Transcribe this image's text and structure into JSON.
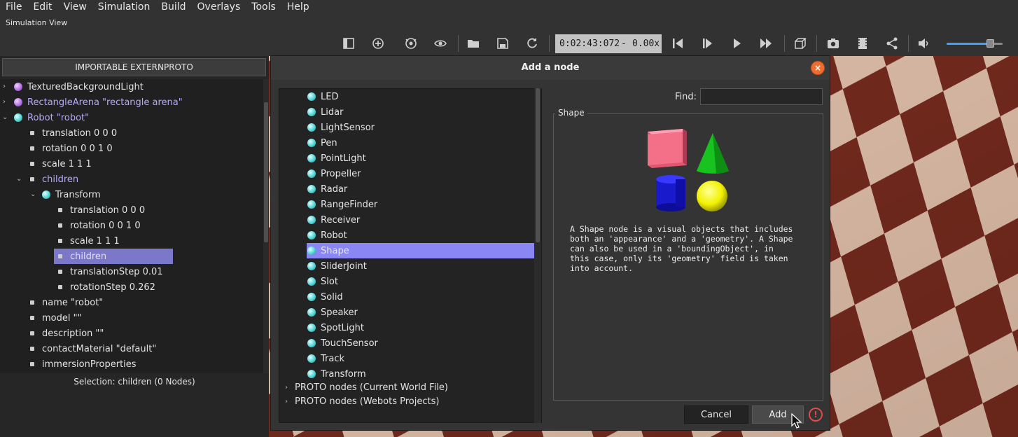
{
  "menu": [
    "File",
    "Edit",
    "View",
    "Simulation",
    "Build",
    "Overlays",
    "Tools",
    "Help"
  ],
  "simulation_view_label": "Simulation View",
  "toolbar": {
    "time": "0:02:43:072",
    "time_separator": "-",
    "speed": "0.00x",
    "volume_level": 0.75,
    "icons": [
      "toggle-scene-tree-icon",
      "add-node-icon",
      "reset-view-icon",
      "visibility-icon",
      "open-world-icon",
      "save-world-icon",
      "reload-world-icon",
      "step-back-icon",
      "step-icon",
      "play-icon",
      "fast-forward-icon",
      "view-cube-icon",
      "screenshot-icon",
      "movie-icon",
      "share-icon",
      "volume-icon"
    ]
  },
  "left_panel": {
    "externproto_button": "IMPORTABLE EXTERNPROTO",
    "tree": [
      {
        "label": "TexturedBackgroundLight"
      },
      {
        "label": "RectangleArena \"rectangle arena\""
      },
      {
        "label": "Robot \"robot\""
      },
      {
        "label": "translation 0 0 0"
      },
      {
        "label": "rotation 0 0 1 0"
      },
      {
        "label": "scale 1 1 1"
      },
      {
        "label": "children"
      },
      {
        "label": "Transform"
      },
      {
        "label": "translation 0 0 0"
      },
      {
        "label": "rotation 0 0 1 0"
      },
      {
        "label": "scale 1 1 1"
      },
      {
        "label": "children"
      },
      {
        "label": "translationStep 0.01"
      },
      {
        "label": "rotationStep 0.262"
      },
      {
        "label": "name \"robot\""
      },
      {
        "label": "model \"\""
      },
      {
        "label": "description \"\""
      },
      {
        "label": "contactMaterial \"default\""
      },
      {
        "label": "immersionProperties"
      }
    ],
    "selection_status": "Selection: children (0 Nodes)"
  },
  "dialog": {
    "title": "Add a node",
    "nodes": [
      "LED",
      "Lidar",
      "LightSensor",
      "Pen",
      "PointLight",
      "Propeller",
      "Radar",
      "RangeFinder",
      "Receiver",
      "Robot",
      "Shape",
      "SliderJoint",
      "Slot",
      "Solid",
      "Speaker",
      "SpotLight",
      "TouchSensor",
      "Track",
      "Transform"
    ],
    "selected_node": "Shape",
    "groups": [
      "PROTO nodes (Current World File)",
      "PROTO nodes (Webots Projects)"
    ],
    "find_label": "Find:",
    "find_value": "",
    "info_title": "Shape",
    "info_description": "A Shape node is a visual objects that includes\nboth an 'appearance' and a 'geometry'. A Shape\ncan also be used in a 'boundingObject', in\nthis case, only its 'geometry' field is taken\ninto account.",
    "cancel_label": "Cancel",
    "add_label": "Add",
    "warning_symbol": "!"
  },
  "colors": {
    "selection": "#8a87f5",
    "tree_selection": "#7b78c9",
    "close_button": "#ef6d2f",
    "warning": "#e24a4a",
    "accent_blue": "#3fa2ff"
  }
}
